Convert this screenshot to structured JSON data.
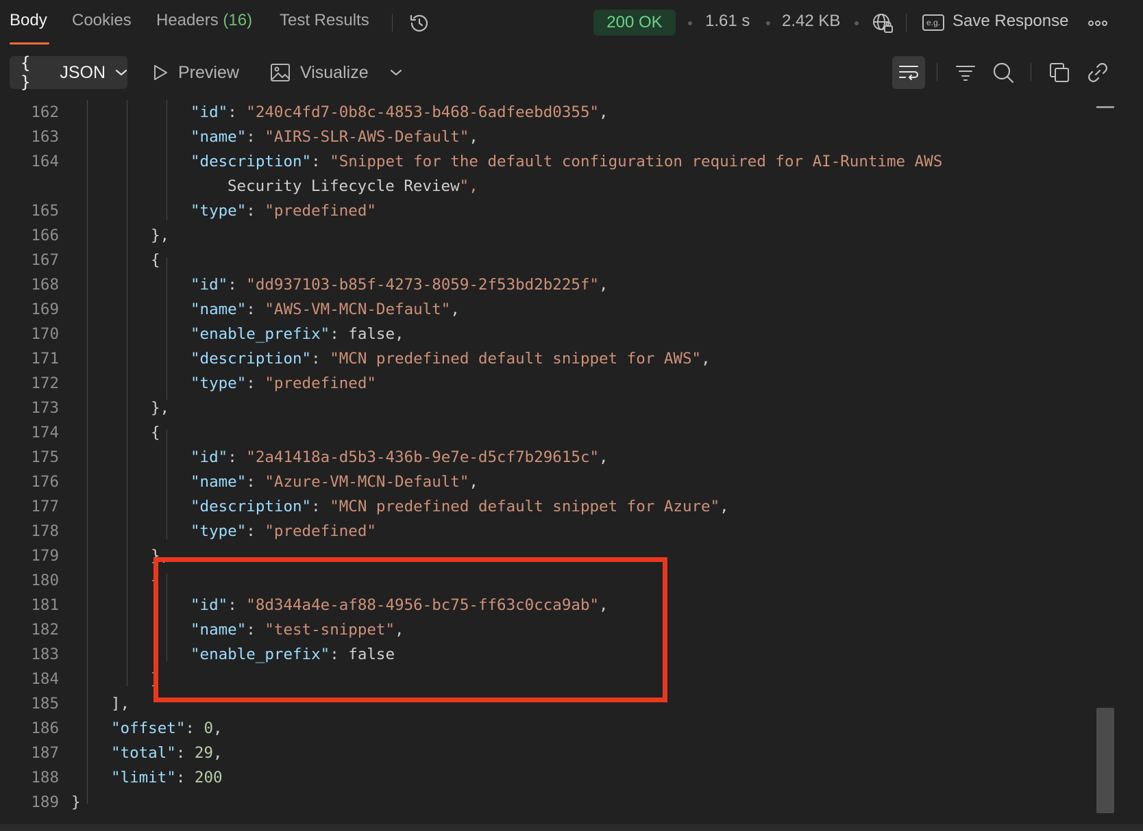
{
  "tabs": {
    "body": "Body",
    "cookies": "Cookies",
    "headers_label": "Headers",
    "headers_count": "(16)",
    "test_results": "Test Results"
  },
  "response": {
    "status": "200 OK",
    "time": "1.61 s",
    "size": "2.42 KB",
    "save_label": "Save Response",
    "save_icon_text": "e.g."
  },
  "toolbar": {
    "format": "JSON",
    "format_braces": "{ }",
    "preview": "Preview",
    "visualize": "Visualize"
  },
  "colors": {
    "accent": "#ff6c37",
    "status_green": "#6cd18a",
    "highlight": "#e8391e"
  },
  "icons": [
    "history-icon",
    "globe-lock-icon",
    "more-icon",
    "wrap-lines-icon",
    "filter-icon",
    "search-icon",
    "copy-icon",
    "link-icon",
    "play-icon",
    "image-icon",
    "chevron-down-icon"
  ],
  "code_lines": [
    {
      "n": "162",
      "t": "\"id\": \"240c4fd7-0b8c-4853-b468-6adfeebd0355\","
    },
    {
      "n": "163",
      "t": "\"name\": \"AIRS-SLR-AWS-Default\","
    },
    {
      "n": "164",
      "t": "\"description\": \"Snippet for the default configuration required for AI-Runtime AWS"
    },
    {
      "n": "",
      "t": "Security Lifecycle Review\","
    },
    {
      "n": "165",
      "t": "\"type\": \"predefined\""
    },
    {
      "n": "166",
      "t": "},"
    },
    {
      "n": "167",
      "t": "{"
    },
    {
      "n": "168",
      "t": "\"id\": \"dd937103-b85f-4273-8059-2f53bd2b225f\","
    },
    {
      "n": "169",
      "t": "\"name\": \"AWS-VM-MCN-Default\","
    },
    {
      "n": "170",
      "t": "\"enable_prefix\": false,"
    },
    {
      "n": "171",
      "t": "\"description\": \"MCN predefined default snippet for AWS\","
    },
    {
      "n": "172",
      "t": "\"type\": \"predefined\""
    },
    {
      "n": "173",
      "t": "},"
    },
    {
      "n": "174",
      "t": "{"
    },
    {
      "n": "175",
      "t": "\"id\": \"2a41418a-d5b3-436b-9e7e-d5cf7b29615c\","
    },
    {
      "n": "176",
      "t": "\"name\": \"Azure-VM-MCN-Default\","
    },
    {
      "n": "177",
      "t": "\"description\": \"MCN predefined default snippet for Azure\","
    },
    {
      "n": "178",
      "t": "\"type\": \"predefined\""
    },
    {
      "n": "179",
      "t": "},"
    },
    {
      "n": "180",
      "t": "{"
    },
    {
      "n": "181",
      "t": "\"id\": \"8d344a4e-af88-4956-bc75-ff63c0cca9ab\","
    },
    {
      "n": "182",
      "t": "\"name\": \"test-snippet\","
    },
    {
      "n": "183",
      "t": "\"enable_prefix\": false"
    },
    {
      "n": "184",
      "t": "}"
    },
    {
      "n": "185",
      "t": "],"
    },
    {
      "n": "186",
      "t": "\"offset\": 0,"
    },
    {
      "n": "187",
      "t": "\"total\": 29,"
    },
    {
      "n": "188",
      "t": "\"limit\": 200"
    },
    {
      "n": "189",
      "t": "}"
    }
  ]
}
